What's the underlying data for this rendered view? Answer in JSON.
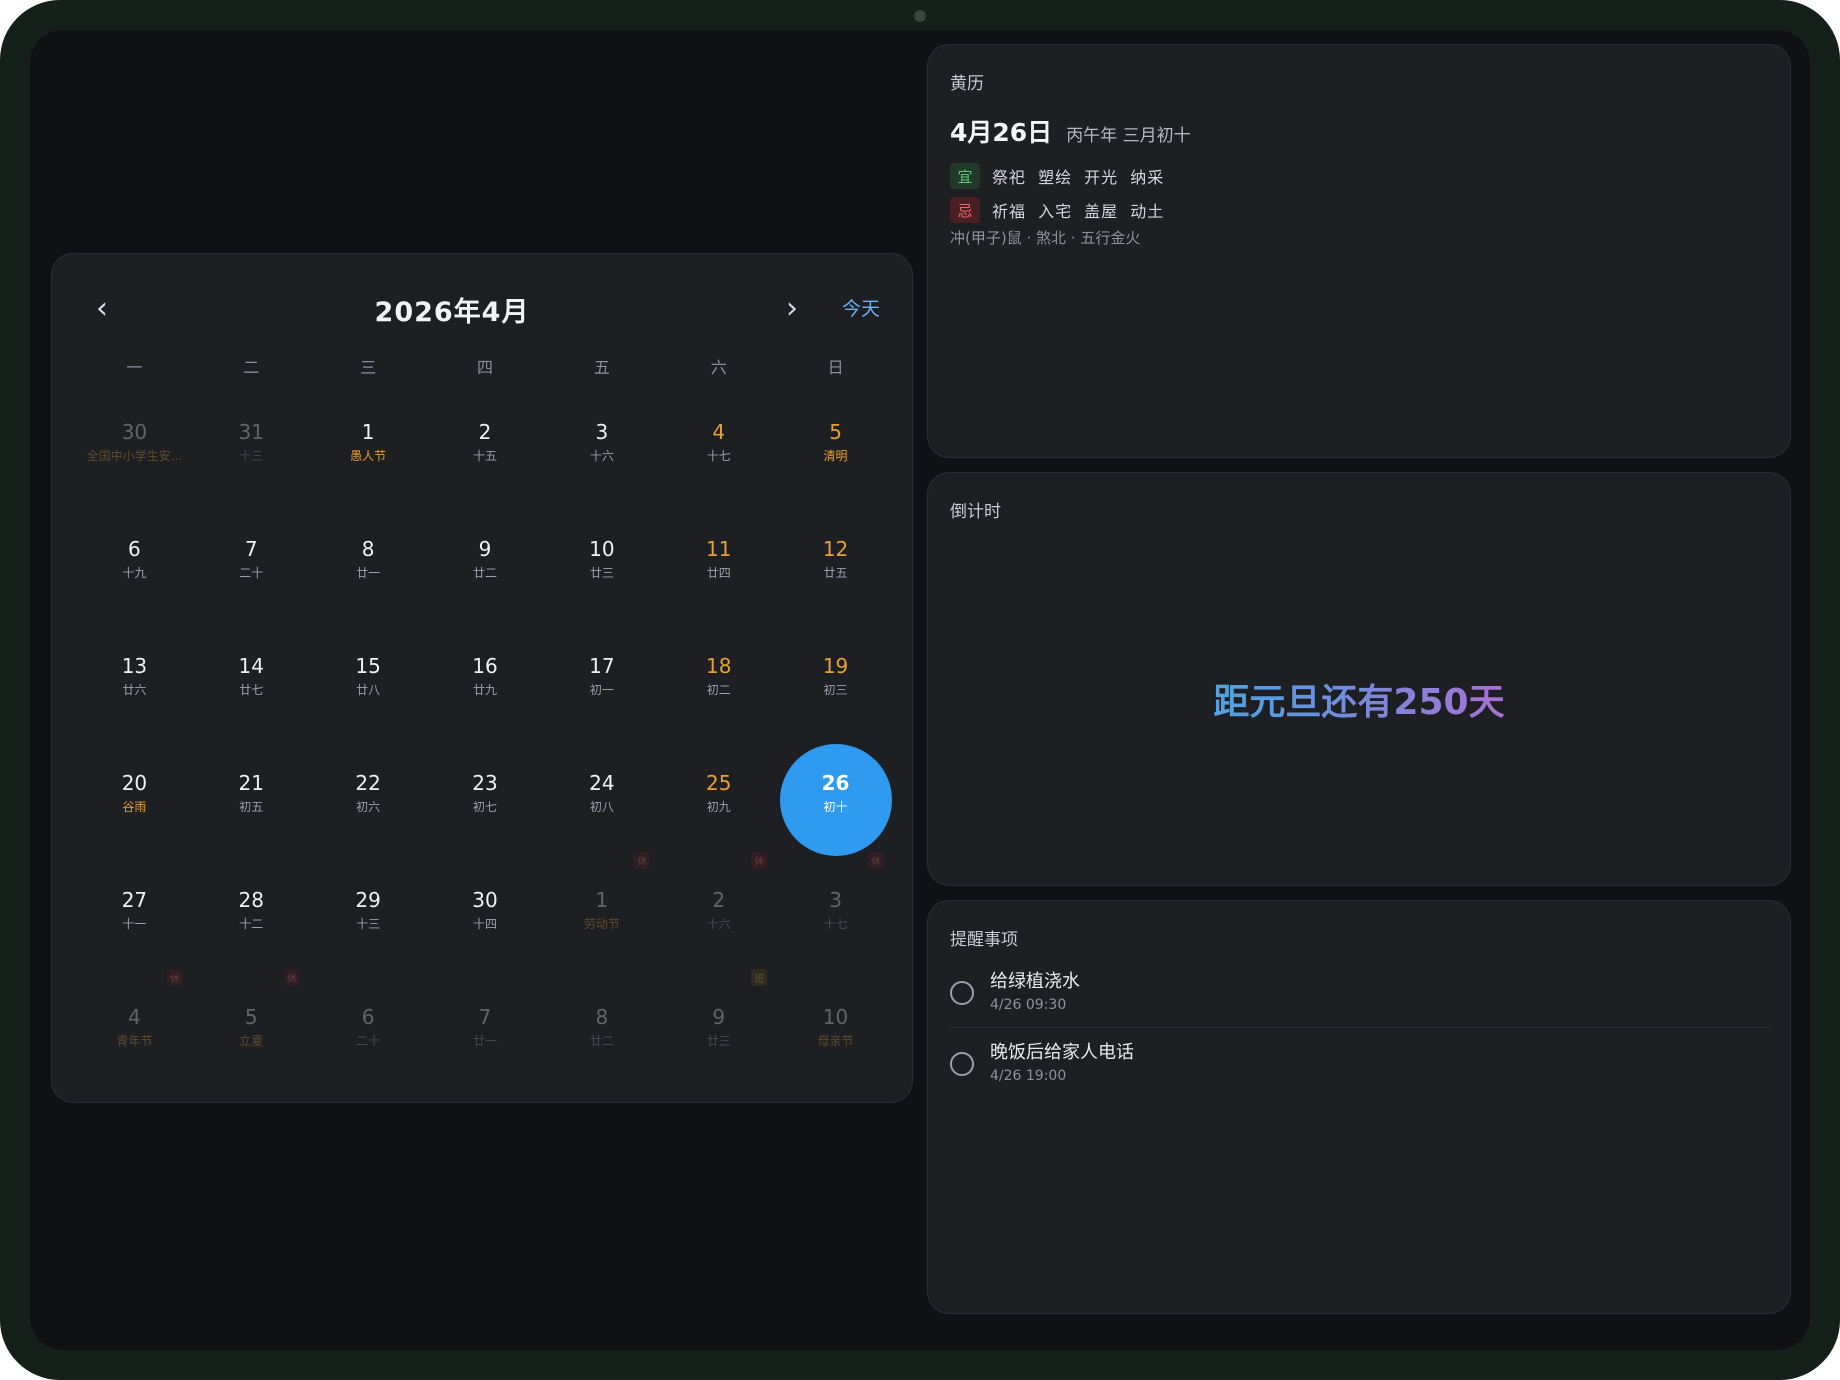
{
  "calendar": {
    "title": "2026年4月",
    "today_label": "今天",
    "prev_icon": "‹",
    "next_icon": "›",
    "weekdays": [
      "一",
      "二",
      "三",
      "四",
      "五",
      "六",
      "日"
    ],
    "days": [
      {
        "num": "30",
        "sub": "全国中小学生安...",
        "type": "other festival"
      },
      {
        "num": "31",
        "sub": "十三",
        "type": "other"
      },
      {
        "num": "1",
        "sub": "愚人节",
        "type": "festival"
      },
      {
        "num": "2",
        "sub": "十五",
        "type": ""
      },
      {
        "num": "3",
        "sub": "十六",
        "type": ""
      },
      {
        "num": "4",
        "sub": "十七",
        "type": "weekend"
      },
      {
        "num": "5",
        "sub": "清明",
        "type": "weekend festival"
      },
      {
        "num": "6",
        "sub": "十九",
        "type": ""
      },
      {
        "num": "7",
        "sub": "二十",
        "type": ""
      },
      {
        "num": "8",
        "sub": "廿一",
        "type": ""
      },
      {
        "num": "9",
        "sub": "廿二",
        "type": ""
      },
      {
        "num": "10",
        "sub": "廿三",
        "type": ""
      },
      {
        "num": "11",
        "sub": "廿四",
        "type": "weekend"
      },
      {
        "num": "12",
        "sub": "廿五",
        "type": "weekend"
      },
      {
        "num": "13",
        "sub": "廿六",
        "type": ""
      },
      {
        "num": "14",
        "sub": "廿七",
        "type": ""
      },
      {
        "num": "15",
        "sub": "廿八",
        "type": ""
      },
      {
        "num": "16",
        "sub": "廿九",
        "type": ""
      },
      {
        "num": "17",
        "sub": "初一",
        "type": ""
      },
      {
        "num": "18",
        "sub": "初二",
        "type": "weekend"
      },
      {
        "num": "19",
        "sub": "初三",
        "type": "weekend"
      },
      {
        "num": "20",
        "sub": "谷雨",
        "type": "festival"
      },
      {
        "num": "21",
        "sub": "初五",
        "type": ""
      },
      {
        "num": "22",
        "sub": "初六",
        "type": ""
      },
      {
        "num": "23",
        "sub": "初七",
        "type": ""
      },
      {
        "num": "24",
        "sub": "初八",
        "type": ""
      },
      {
        "num": "25",
        "sub": "初九",
        "type": "weekend"
      },
      {
        "num": "26",
        "sub": "初十",
        "type": "selected"
      },
      {
        "num": "27",
        "sub": "十一",
        "type": ""
      },
      {
        "num": "28",
        "sub": "十二",
        "type": ""
      },
      {
        "num": "29",
        "sub": "十三",
        "type": ""
      },
      {
        "num": "30",
        "sub": "十四",
        "type": ""
      },
      {
        "num": "1",
        "sub": "劳动节",
        "type": "other festival",
        "badge": "休"
      },
      {
        "num": "2",
        "sub": "十六",
        "type": "other",
        "badge": "休"
      },
      {
        "num": "3",
        "sub": "十七",
        "type": "other",
        "badge": "休"
      },
      {
        "num": "4",
        "sub": "青年节",
        "type": "other festival",
        "badge": "休"
      },
      {
        "num": "5",
        "sub": "立夏",
        "type": "other festival",
        "badge": "休"
      },
      {
        "num": "6",
        "sub": "二十",
        "type": "other"
      },
      {
        "num": "7",
        "sub": "廿一",
        "type": "other"
      },
      {
        "num": "8",
        "sub": "廿二",
        "type": "other"
      },
      {
        "num": "9",
        "sub": "廿三",
        "type": "other",
        "badge": "班",
        "badge_type": "work"
      },
      {
        "num": "10",
        "sub": "母亲节",
        "type": "other festival"
      }
    ]
  },
  "almanac": {
    "title": "黄历",
    "date": "4月26日",
    "lunar": "丙午年 三月初十",
    "good_tag": "宜",
    "good_items": "祭祀 塑绘 开光 纳采",
    "bad_tag": "忌",
    "bad_items": "祈福 入宅 盖屋 动土",
    "footer": "冲(甲子)鼠 · 煞北 · 五行金火"
  },
  "countdown": {
    "title": "倒计时",
    "text": "距元旦还有250天"
  },
  "reminders": {
    "title": "提醒事项",
    "items": [
      {
        "title": "给绿植浇水",
        "time": "4/26 09:30"
      },
      {
        "title": "晚饭后给家人电话",
        "time": "4/26 19:00"
      }
    ]
  }
}
